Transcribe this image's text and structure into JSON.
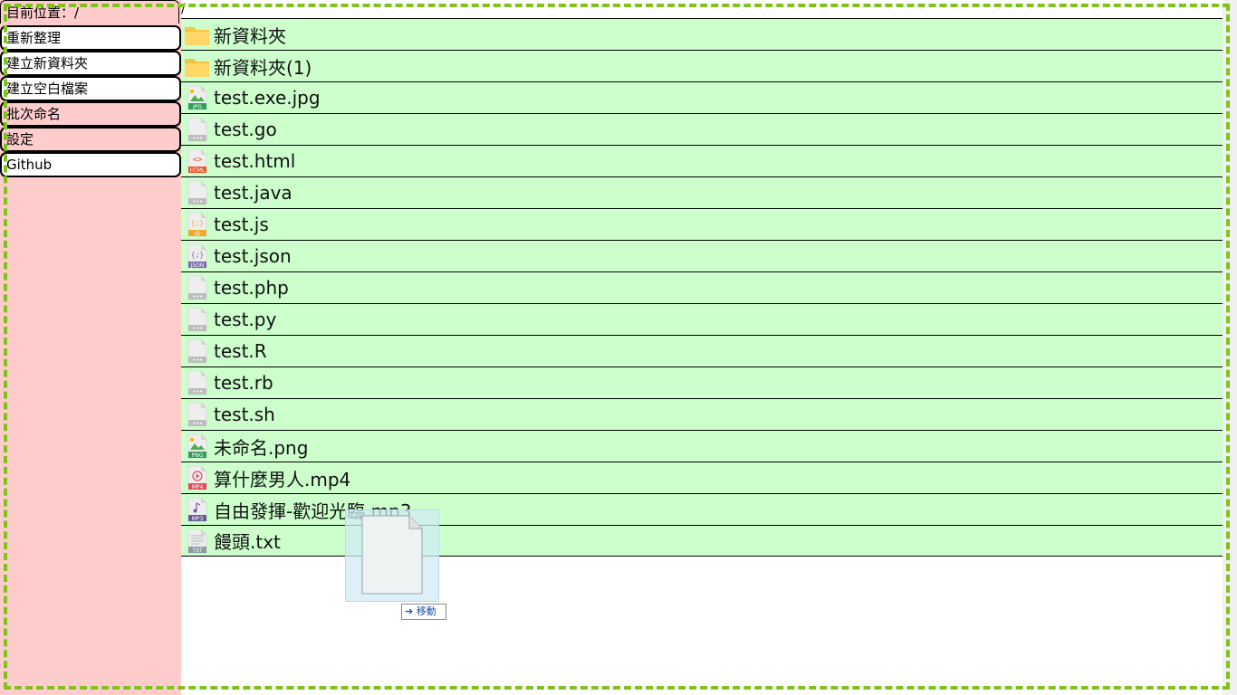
{
  "sidebar": {
    "location_label": "目前位置：/",
    "buttons": [
      {
        "label": "重新整理",
        "style": "white"
      },
      {
        "label": "建立新資料夾",
        "style": "white"
      },
      {
        "label": "建立空白檔案",
        "style": "white"
      },
      {
        "label": "批次命名",
        "style": "pink"
      },
      {
        "label": "設定",
        "style": "pink"
      },
      {
        "label": "Github",
        "style": "white"
      }
    ]
  },
  "main": {
    "path": "/",
    "files": [
      {
        "name": "新資料夾",
        "icon": "folder-icon"
      },
      {
        "name": "新資料夾(1)",
        "icon": "folder-icon"
      },
      {
        "name": "test.exe.jpg",
        "icon": "jpg-file-icon"
      },
      {
        "name": "test.go",
        "icon": "generic-file-icon"
      },
      {
        "name": "test.html",
        "icon": "html-file-icon"
      },
      {
        "name": "test.java",
        "icon": "generic-file-icon"
      },
      {
        "name": "test.js",
        "icon": "js-file-icon"
      },
      {
        "name": "test.json",
        "icon": "json-file-icon"
      },
      {
        "name": "test.php",
        "icon": "generic-file-icon"
      },
      {
        "name": "test.py",
        "icon": "generic-file-icon"
      },
      {
        "name": "test.R",
        "icon": "generic-file-icon"
      },
      {
        "name": "test.rb",
        "icon": "generic-file-icon"
      },
      {
        "name": "test.sh",
        "icon": "generic-file-icon"
      },
      {
        "name": "未命名.png",
        "icon": "png-file-icon"
      },
      {
        "name": "算什麼男人.mp4",
        "icon": "mp4-file-icon"
      },
      {
        "name": "自由發揮-歡迎光臨.mp3",
        "icon": "mp3-file-icon"
      },
      {
        "name": "饅頭.txt",
        "icon": "txt-file-icon"
      }
    ]
  },
  "drag": {
    "tooltip": "移動"
  },
  "colors": {
    "sidebar_bg": "#ffcccc",
    "row_bg": "#ccffcc",
    "dashed_border": "#7ec31c"
  }
}
